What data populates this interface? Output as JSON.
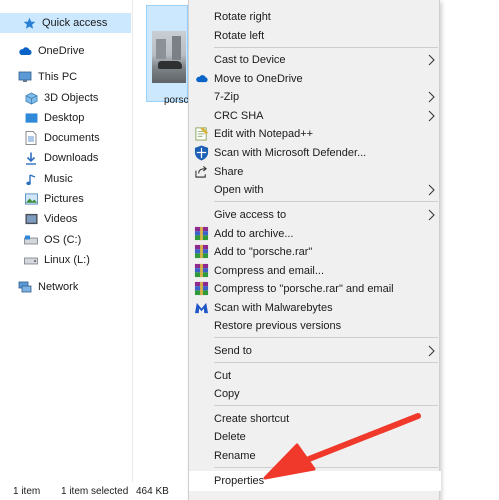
{
  "nav": {
    "items": [
      {
        "label": "Quick access",
        "icon": "star-icon"
      },
      {
        "label": "OneDrive",
        "icon": "cloud-icon"
      },
      {
        "label": "This PC",
        "icon": "computer-icon"
      },
      {
        "label": "3D Objects",
        "icon": "cube-icon"
      },
      {
        "label": "Desktop",
        "icon": "desktop-icon"
      },
      {
        "label": "Documents",
        "icon": "document-icon"
      },
      {
        "label": "Downloads",
        "icon": "download-icon"
      },
      {
        "label": "Music",
        "icon": "music-icon"
      },
      {
        "label": "Pictures",
        "icon": "pictures-icon"
      },
      {
        "label": "Videos",
        "icon": "videos-icon"
      },
      {
        "label": "OS (C:)",
        "icon": "drive-icon"
      },
      {
        "label": "Linux (L:)",
        "icon": "drive-icon"
      },
      {
        "label": "Network",
        "icon": "network-icon"
      }
    ],
    "selected": "Quick access"
  },
  "file": {
    "name": "porsc"
  },
  "status": {
    "count": "1 item",
    "selection": "1 item selected",
    "size": "464 KB"
  },
  "menu": {
    "items": [
      {
        "label": "Rotate right",
        "icon": "",
        "submenu": false
      },
      {
        "label": "Rotate left",
        "icon": "",
        "submenu": false
      },
      {
        "label": "Cast to Device",
        "icon": "",
        "submenu": true
      },
      {
        "label": "Move to OneDrive",
        "icon": "onedrive-cloud-icon",
        "submenu": false
      },
      {
        "label": "7-Zip",
        "icon": "",
        "submenu": true
      },
      {
        "label": "CRC SHA",
        "icon": "",
        "submenu": true
      },
      {
        "label": "Edit with Notepad++",
        "icon": "notepad-plus-plus-icon",
        "submenu": false
      },
      {
        "label": "Scan with Microsoft Defender...",
        "icon": "defender-shield-icon",
        "submenu": false
      },
      {
        "label": "Share",
        "icon": "share-icon",
        "submenu": false
      },
      {
        "label": "Open with",
        "icon": "",
        "submenu": true
      },
      {
        "label": "Give access to",
        "icon": "",
        "submenu": true
      },
      {
        "label": "Add to archive...",
        "icon": "winrar-icon",
        "submenu": false
      },
      {
        "label": "Add to \"porsche.rar\"",
        "icon": "winrar-icon",
        "submenu": false
      },
      {
        "label": "Compress and email...",
        "icon": "winrar-icon",
        "submenu": false
      },
      {
        "label": "Compress to \"porsche.rar\" and email",
        "icon": "winrar-icon",
        "submenu": false
      },
      {
        "label": "Scan with Malwarebytes",
        "icon": "malwarebytes-icon",
        "submenu": false
      },
      {
        "label": "Restore previous versions",
        "icon": "",
        "submenu": false
      },
      {
        "label": "Send to",
        "icon": "",
        "submenu": true
      },
      {
        "label": "Cut",
        "icon": "",
        "submenu": false
      },
      {
        "label": "Copy",
        "icon": "",
        "submenu": false
      },
      {
        "label": "Create shortcut",
        "icon": "",
        "submenu": false
      },
      {
        "label": "Delete",
        "icon": "",
        "submenu": false
      },
      {
        "label": "Rename",
        "icon": "",
        "submenu": false
      },
      {
        "label": "Properties",
        "icon": "",
        "submenu": false
      }
    ],
    "highlighted": "Properties"
  },
  "colors": {
    "selection": "#cce8ff",
    "menu_bg": "#f0f0f0",
    "highlight": "#ffffff",
    "pointer_arrow": "#f0392b",
    "onedrive": "#0a64c8"
  }
}
